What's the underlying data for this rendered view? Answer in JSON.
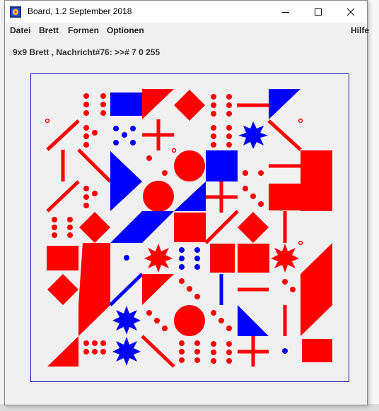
{
  "window": {
    "title": "Board, 1.2 September 2018",
    "controls": [
      "minimize",
      "maximize",
      "close"
    ]
  },
  "menu": {
    "datei": "Datei",
    "brett": "Brett",
    "formen": "Formen",
    "optionen": "Optionen",
    "hilfe": "Hilfe"
  },
  "status": {
    "message": "9x9 Brett , Nachricht#76: >># 7 0 255"
  },
  "board": {
    "grid": 9,
    "colors": {
      "red": "#ff0000",
      "blue": "#0000ff",
      "frame": "#1a1aa8",
      "background": "#f0f0f0"
    }
  }
}
